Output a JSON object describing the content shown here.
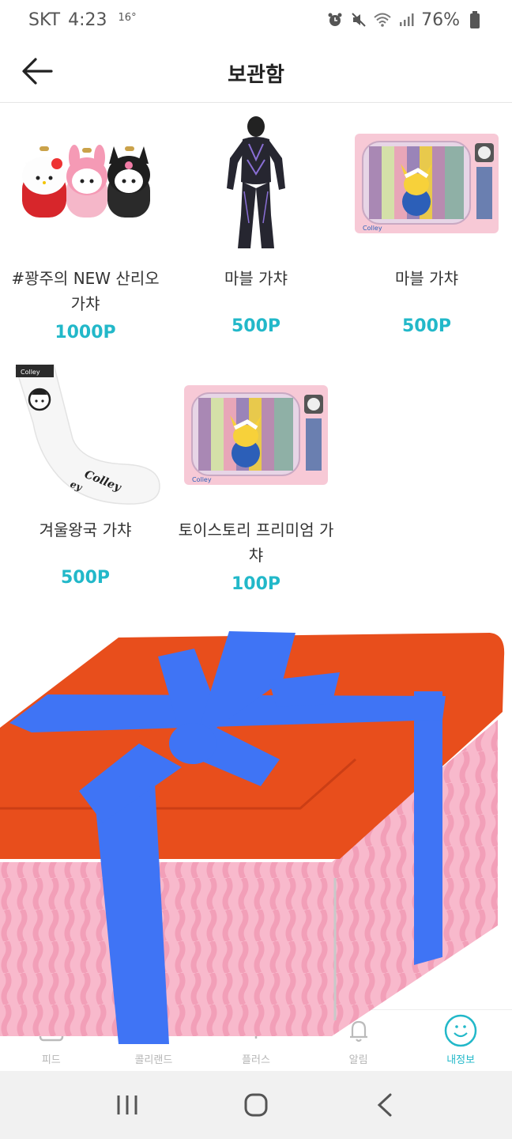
{
  "status_bar": {
    "carrier": "SKT",
    "time": "4:23",
    "temperature": "16°",
    "battery": "76%",
    "icons": [
      "alarm-icon",
      "mute-icon",
      "wifi-icon",
      "signal-icon",
      "battery-icon"
    ]
  },
  "header": {
    "title": "보관함",
    "back_icon": "arrow-left-icon"
  },
  "items": [
    {
      "name": "#꽝주의 NEW 산리오 가챠",
      "price": "1000P",
      "image": "sanrio-plush-image"
    },
    {
      "name": "마블 가챠",
      "price": "500P",
      "image": "black-panther-figure-image"
    },
    {
      "name": "마블 가챠",
      "price": "500P",
      "image": "retro-tv-pikachu-image"
    },
    {
      "name": "겨울왕국 가챠",
      "price": "500P",
      "image": "colley-sock-image"
    },
    {
      "name": "토이스토리 프리미엄 가챠",
      "price": "100P",
      "image": "retro-tv-pikachu-image"
    }
  ],
  "bottom_nav": [
    {
      "label": "피드",
      "icon": "feed-icon",
      "active": false
    },
    {
      "label": "콜리랜드",
      "icon": "colleyland-icon",
      "active": false
    },
    {
      "label": "플러스",
      "icon": "plus-icon",
      "active": false
    },
    {
      "label": "알림",
      "icon": "bell-icon",
      "active": false
    },
    {
      "label": "내정보",
      "icon": "smile-icon",
      "active": true
    }
  ],
  "system_nav": {
    "buttons": [
      "recent-apps-icon",
      "home-icon",
      "back-chevron-icon"
    ]
  },
  "colors": {
    "accent": "#22b8c9",
    "gift_lid": "#e84e1c",
    "gift_ribbon": "#3f74f5",
    "gift_box": "#f8b9cc"
  }
}
